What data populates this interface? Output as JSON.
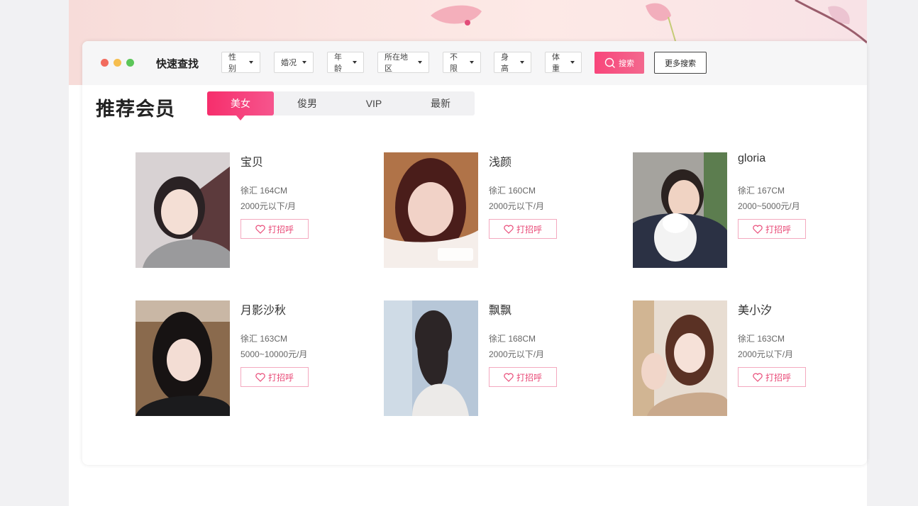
{
  "colors": {
    "accent": "#f6427c",
    "window_red": "#f26b5e",
    "window_yellow": "#f6be4f",
    "window_green": "#5cc659"
  },
  "search": {
    "title": "快速查找",
    "filters": [
      {
        "label": "性别"
      },
      {
        "label": "婚况"
      },
      {
        "label": "年龄"
      },
      {
        "label": "所在地区"
      },
      {
        "label": "不限"
      },
      {
        "label": "身高"
      },
      {
        "label": "体重"
      }
    ],
    "search_button": "搜索",
    "more_button": "更多搜索",
    "search_icon": "search-icon"
  },
  "section": {
    "title": "推荐会员",
    "tabs": [
      {
        "label": "美女",
        "active": true
      },
      {
        "label": "俊男",
        "active": false
      },
      {
        "label": "VIP",
        "active": false
      },
      {
        "label": "最新",
        "active": false
      }
    ]
  },
  "members": [
    {
      "name": "宝贝",
      "location_height": "徐汇 164CM",
      "income": "2000元以下/月",
      "greet": "打招呼"
    },
    {
      "name": "浅颜",
      "location_height": "徐汇 160CM",
      "income": "2000元以下/月",
      "greet": "打招呼"
    },
    {
      "name": "gloria",
      "location_height": "徐汇 167CM",
      "income": "2000~5000元/月",
      "greet": "打招呼"
    },
    {
      "name": "月影沙秋",
      "location_height": "徐汇 163CM",
      "income": "5000~10000元/月",
      "greet": "打招呼"
    },
    {
      "name": "飘飘",
      "location_height": "徐汇 168CM",
      "income": "2000元以下/月",
      "greet": "打招呼"
    },
    {
      "name": "美小汐",
      "location_height": "徐汇 163CM",
      "income": "2000元以下/月",
      "greet": "打招呼"
    }
  ]
}
